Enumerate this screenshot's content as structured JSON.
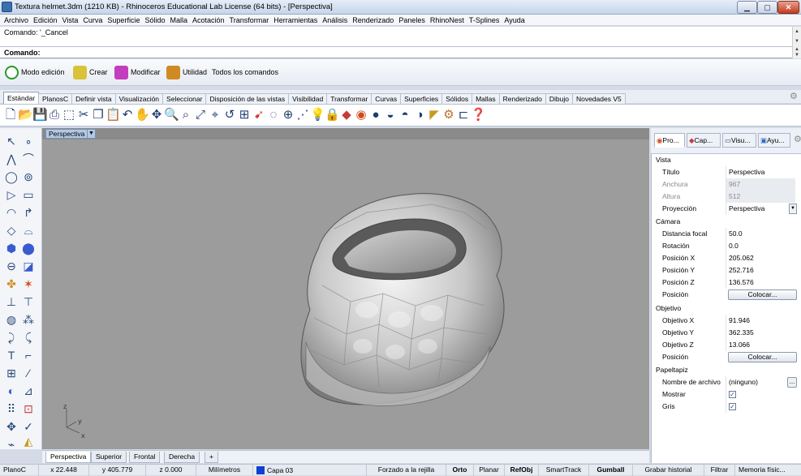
{
  "window": {
    "title": "Textura helmet.3dm (1210 KB) - Rhinoceros Educational Lab License (64 bits) - [Perspectiva]"
  },
  "menu": [
    "Archivo",
    "Edición",
    "Vista",
    "Curva",
    "Superficie",
    "Sólido",
    "Malla",
    "Acotación",
    "Transformar",
    "Herramientas",
    "Análisis",
    "Renderizado",
    "Paneles",
    "RhinoNest",
    "T-Splines",
    "Ayuda"
  ],
  "command": {
    "history": "Comando: '_Cancel",
    "prompt": "Comando:"
  },
  "quick_toolbar": {
    "items": [
      "Modo edición",
      "Crear",
      "Modificar",
      "Utilidad",
      "Todos los comandos"
    ]
  },
  "toolbar_tabs": [
    "Estándar",
    "PlanosC",
    "Definir vista",
    "Visualización",
    "Seleccionar",
    "Disposición de las vistas",
    "Visibilidad",
    "Transformar",
    "Curvas",
    "Superficies",
    "Sólidos",
    "Mallas",
    "Renderizado",
    "Dibujo",
    "Novedades V5"
  ],
  "viewport": {
    "label": "Perspectiva",
    "axis": {
      "z": "z",
      "y": "y",
      "x": "x"
    },
    "tabs": [
      "Perspectiva",
      "Superior",
      "Frontal",
      "Derecha"
    ],
    "add_tab": "+",
    "background_color": "#9c9c9c"
  },
  "panel": {
    "tabs": [
      "Pro...",
      "Cap...",
      "Visu...",
      "Ayu..."
    ],
    "sections": {
      "vista": "Vista",
      "camara": "Cámara",
      "objetivo": "Objetivo",
      "papeltapiz": "Papeltapiz"
    },
    "vista": {
      "titulo_k": "Título",
      "titulo_v": "Perspectiva",
      "anchura_k": "Anchura",
      "anchura_v": "967",
      "altura_k": "Altura",
      "altura_v": "512",
      "proyeccion_k": "Proyección",
      "proyeccion_v": "Perspectiva"
    },
    "camara": {
      "focal_k": "Distancia focal",
      "focal_v": "50.0",
      "rotacion_k": "Rotación",
      "rotacion_v": "0.0",
      "px_k": "Posición X",
      "px_v": "205.062",
      "py_k": "Posición Y",
      "py_v": "252.716",
      "pz_k": "Posición Z",
      "pz_v": "136.576",
      "pos_k": "Posición",
      "pos_btn": "Colocar..."
    },
    "objetivo": {
      "ox_k": "Objetivo X",
      "ox_v": "91.946",
      "oy_k": "Objetivo Y",
      "oy_v": "362.335",
      "oz_k": "Objetivo Z",
      "oz_v": "13.066",
      "pos_k": "Posición",
      "pos_btn": "Colocar..."
    },
    "papeltapiz": {
      "archivo_k": "Nombre de archivo",
      "archivo_v": "(ninguno)",
      "mostrar_k": "Mostrar",
      "mostrar_checked": true,
      "gris_k": "Gris",
      "gris_checked": true,
      "more_btn": "..."
    }
  },
  "status": {
    "plane": "PlanoC",
    "x": "x 22.448",
    "y": "y 405.779",
    "z": "z 0.000",
    "units": "Milímetros",
    "layer": "Capa 03",
    "layer_color": "#1040d0",
    "grid_snap": "Forzado a la rejilla",
    "orto": "Orto",
    "planar": "Planar",
    "refobj": "RefObj",
    "smarttrack": "SmartTrack",
    "gumball": "Gumball",
    "history": "Grabar historial",
    "filter": "Filtrar",
    "memory": "Memoria físic..."
  }
}
